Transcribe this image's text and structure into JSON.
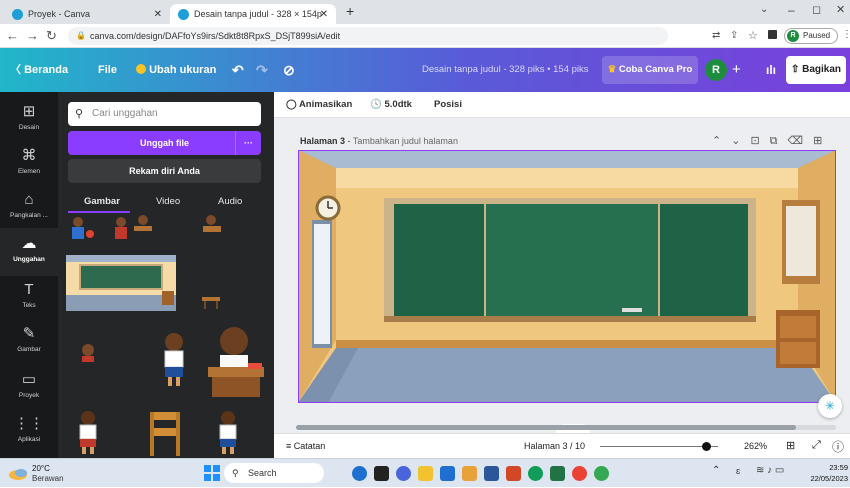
{
  "browser": {
    "tabs": [
      {
        "title": "Proyek - Canva",
        "active": false
      },
      {
        "title": "Desain tanpa judul - 328 × 154p",
        "active": true
      }
    ],
    "new_tab": "+",
    "url": "canva.com/design/DAFfoYs9irs/Sdkt8t8RpxS_DSjT899siA/edit",
    "paused_label": "Paused",
    "profile_initial": "R"
  },
  "header": {
    "home": "Beranda",
    "file": "File",
    "resize": "Ubah ukuran",
    "design_title": "Desain tanpa judul - 328 piks • 154 piks",
    "try_pro": "Coba Canva Pro",
    "avatar": "R",
    "plus": "+",
    "share": "Bagikan"
  },
  "rail": [
    {
      "icon": "template-icon",
      "glyph": "⊞",
      "label": "Desain"
    },
    {
      "icon": "elements-icon",
      "glyph": "⌘",
      "label": "Elemen"
    },
    {
      "icon": "brand-icon",
      "glyph": "⌂",
      "label": "Pangkalan ..."
    },
    {
      "icon": "upload-cloud-icon",
      "glyph": "☁",
      "label": "Unggahan"
    },
    {
      "icon": "text-icon",
      "glyph": "T",
      "label": "Teks"
    },
    {
      "icon": "draw-icon",
      "glyph": "✎",
      "label": "Gambar"
    },
    {
      "icon": "folder-icon",
      "glyph": "▭",
      "label": "Proyek"
    },
    {
      "icon": "apps-icon",
      "glyph": "⋮⋮",
      "label": "Aplikasi"
    }
  ],
  "panel": {
    "search_placeholder": "Cari unggahan",
    "upload_btn": "Unggah file",
    "more": "···",
    "record_btn": "Rekam diri Anda",
    "tabs": [
      "Gambar",
      "Video",
      "Audio"
    ]
  },
  "toolbar": {
    "animate": "Animasikan",
    "duration": "5.0dtk",
    "position": "Posisi"
  },
  "page": {
    "label": "Halaman 3",
    "separator": " - ",
    "title_placeholder": "Tambahkan judul halaman"
  },
  "footer": {
    "notes": "Catatan",
    "page_indicator": "Halaman 3 / 10",
    "zoom": "262%",
    "zoom_fraction": 0.9
  },
  "taskbar": {
    "temperature": "20°C",
    "weather": "Berawan",
    "search": "Search",
    "time": "23:59",
    "date": "22/05/2023"
  }
}
